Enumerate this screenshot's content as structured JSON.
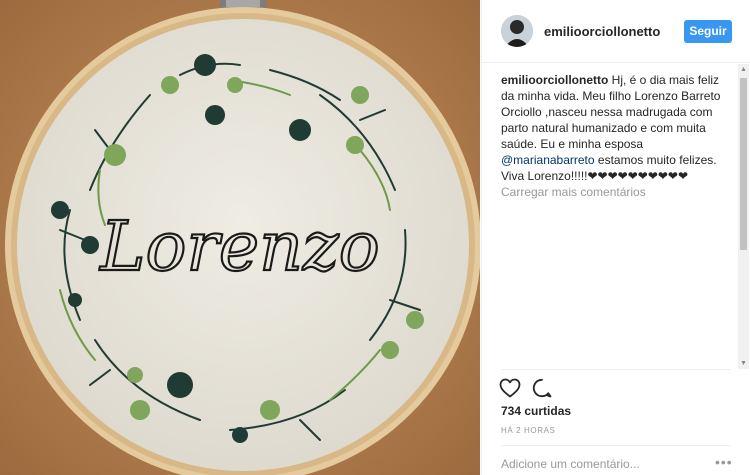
{
  "post": {
    "username": "emilioorciollonetto",
    "follow_label": "Seguir",
    "image": {
      "embroidered_text": "Lorenzo",
      "colors": {
        "wood": "#b98554",
        "hoop": "#e2c89c",
        "fabric": "#ebe8df",
        "thread": "#1a1a1a",
        "leaf_dark": "#1f3b33",
        "leaf_light": "#6f9a4a"
      }
    },
    "caption": {
      "username": "emilioorciollonetto",
      "text_before_mention": " Hj, é o dia mais feliz da minha vida. Meu filho Lorenzo Barreto Orciollo ,nasceu nessa madrugada com parto natural humanizado e com muita saúde. Eu e minha esposa ",
      "mention": "@marianabarreto",
      "text_after_mention": " estamos muito felizes. Viva Lorenzo!!!!!❤❤❤❤❤❤❤❤❤❤"
    },
    "load_more_label": "Carregar mais comentários",
    "likes": "734 curtidas",
    "timestamp": "HÁ 2 HORAS",
    "comment_placeholder": "Adicione um comentário...",
    "more_label": "•••",
    "icons": {
      "like": "heart-outline-icon",
      "comment": "speech-bubble-icon",
      "more": "ellipsis-icon"
    },
    "accent_color": "#3897f0"
  }
}
